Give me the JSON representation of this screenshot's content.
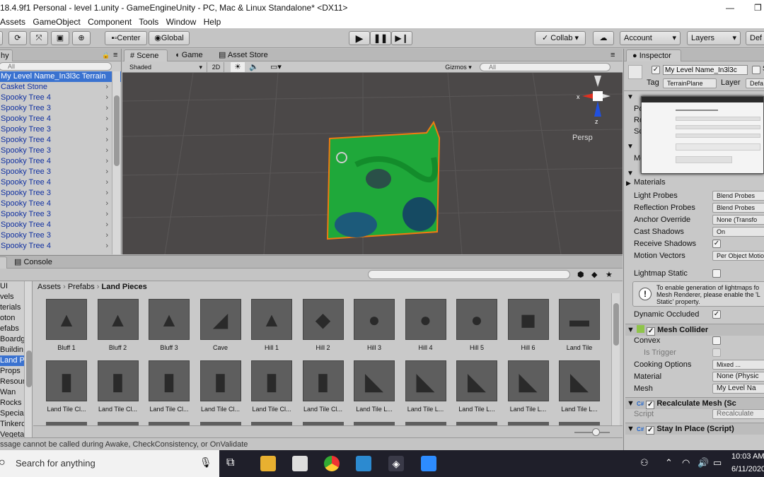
{
  "window": {
    "title": "18.4.9f1 Personal - level 1.unity - GameEngineUnity - PC, Mac & Linux Standalone* <DX11>"
  },
  "menu": [
    "Assets",
    "GameObject",
    "Component",
    "Tools",
    "Window",
    "Help"
  ],
  "toolbar": {
    "pivot": "Center",
    "space": "Global",
    "collab": "Collab ▾",
    "account": "Account",
    "layers": "Layers",
    "layout": "Def"
  },
  "hierarchy": {
    "tab": "hy",
    "search_placeholder": "All",
    "selected": "My Level Name_In3l3c Terrain",
    "items": [
      "Casket Stone",
      "Spooky Tree 4",
      "Spooky Tree 3",
      "Spooky Tree 4",
      "Spooky Tree 3",
      "Spooky Tree 4",
      "Spooky Tree 3",
      "Spooky Tree 4",
      "Spooky Tree 3",
      "Spooky Tree 4",
      "Spooky Tree 3",
      "Spooky Tree 4",
      "Spooky Tree 3",
      "Spooky Tree 4",
      "Spooky Tree 3",
      "Spooky Tree 4"
    ]
  },
  "scene": {
    "tabs": [
      "Scene",
      "Game",
      "Asset Store"
    ],
    "shading": "Shaded",
    "mode2d": "2D",
    "gizmos": "Gizmos ▾",
    "search_placeholder": "All",
    "persp": "Persp",
    "axis_x": "x",
    "axis_z": "z"
  },
  "project": {
    "tabs": [
      "",
      "Console"
    ],
    "breadcrumb": [
      "Assets",
      "Prefabs",
      "Land Pieces"
    ],
    "folders": [
      "UI",
      "vels",
      "terials",
      "oton",
      "efabs",
      "Boardg",
      "Buildin",
      "Land P",
      "Props",
      "Resour",
      "Wan",
      "Rocks",
      "Special",
      "Tinkerc",
      "Vegeta"
    ],
    "assets_row1": [
      "Bluff 1",
      "Bluff 2",
      "Bluff 3",
      "Cave",
      "Hill 1",
      "Hill 2",
      "Hill 3",
      "Hill 4",
      "Hill 5",
      "Hill 6",
      "Land Tile"
    ],
    "assets_row2": [
      "Land Tile Cl...",
      "Land Tile Cl...",
      "Land Tile Cl...",
      "Land Tile Cl...",
      "Land Tile Cl...",
      "Land Tile Cl...",
      "Land Tile L...",
      "Land Tile L...",
      "Land Tile L...",
      "Land Tile L...",
      "Land Tile L..."
    ]
  },
  "status": {
    "message": "ssage cannot be called during Awake, CheckConsistency, or OnValidate"
  },
  "inspector": {
    "tab": "Inspector",
    "object_name": "My Level Name_In3l3c",
    "static_label": "S",
    "tag_label": "Tag",
    "tag": "TerrainPlane",
    "layer_label": "Layer",
    "layer": "Defa",
    "transform_rows": [
      "Po",
      "Ro",
      "Sc"
    ],
    "mesh_row": "Me",
    "materials": "Materials",
    "rows": [
      {
        "label": "Light Probes",
        "value": "Blend Probes"
      },
      {
        "label": "Reflection Probes",
        "value": "Blend Probes"
      },
      {
        "label": "Anchor Override",
        "value": "None (Transfo"
      },
      {
        "label": "Cast Shadows",
        "value": "On"
      },
      {
        "label": "Receive Shadows",
        "value": ""
      },
      {
        "label": "Motion Vectors",
        "value": "Per Object Motio"
      }
    ],
    "lightmap_static": "Lightmap Static",
    "info": "To enable generation of lightmaps fo Mesh Renderer, please enable the 'L Static' property.",
    "dynamic_occluded": "Dynamic Occluded",
    "mesh_collider": {
      "title": "Mesh Collider",
      "convex": "Convex",
      "is_trigger": "Is Trigger",
      "cooking_label": "Cooking Options",
      "cooking": "Mixed ...",
      "material_label": "Material",
      "material": "None (Physic",
      "mesh_label": "Mesh",
      "mesh": "My Level Na"
    },
    "recalc": {
      "title": "Recalculate Mesh (Sc",
      "script_label": "Script",
      "script": "Recalculate"
    },
    "stay": {
      "title": "Stay In Place (Script)"
    }
  },
  "taskbar": {
    "search": "Search for anything",
    "time": "10:03 AM",
    "date": "6/11/2020"
  },
  "colors": {
    "terrain": "#1fa83a",
    "selection": "#f07a10",
    "scene_bg": "#4b4848",
    "taskbar": "#1f1f2a"
  }
}
